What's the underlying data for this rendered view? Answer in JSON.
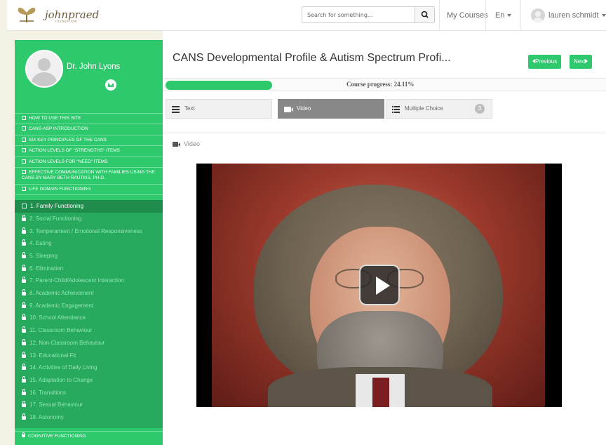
{
  "header": {
    "logo_text": "johnpraed",
    "logo_sub": "FOUNDATION",
    "search_placeholder": "Search for something...",
    "my_courses": "My Courses",
    "language": "En",
    "user_name": "lauren schmidt"
  },
  "sidebar": {
    "profile_name": "Dr. John Lyons",
    "topics": [
      "HOW TO USE THIS SITE",
      "CANS-ASP INTRODUCTION",
      "SIX KEY PRINCIPLES OF THE CANS",
      "ACTION LEVELS OF \"STRENGTHS\" ITEMS",
      "ACTION LEVELS FOR \"NEED\" ITEMS",
      "EFFECTIVE COMMUNICATION WITH FAMILIES USING THE CANS BY MARY BETH RAUTKIS, PH.D.",
      "LIFE DOMAIN FUNCTIONING"
    ],
    "subtopics": [
      "1. Family Functioning",
      "2. Social Functioning",
      "3. Temperament / Emotional Responsiveness",
      "4. Eating",
      "5. Sleeping",
      "6. Elimination",
      "7. Parent-Child/Adolescent Interaction",
      "8. Academic Achievement",
      "9. Academic Engagement",
      "10. School Attendance",
      "11. Classroom Behaviour",
      "12. Non-Classroom Behaviour",
      "13. Educational Fit",
      "14. Activities of Daily Living",
      "15. Adaptation to Change",
      "16. Transitions",
      "17. Sexual Behaviour",
      "18. Autonomy"
    ],
    "next_topic": "COGNITIVE FUNCTIONING"
  },
  "main": {
    "title": "CANS Developmental Profile & Autism Spectrum Profi...",
    "previous": "Previous",
    "next": "Next",
    "progress_label": "Course progress: 24.11%",
    "progress_value": 24.11,
    "tabs": [
      {
        "label": "Text"
      },
      {
        "label": "Video"
      },
      {
        "label": "Multiple Choice",
        "count": "3"
      }
    ],
    "section_label": "Video"
  },
  "colors": {
    "accent": "#2ec96c",
    "sidebar_dark": "#28aa5e",
    "active_item": "#1f8c4c"
  }
}
